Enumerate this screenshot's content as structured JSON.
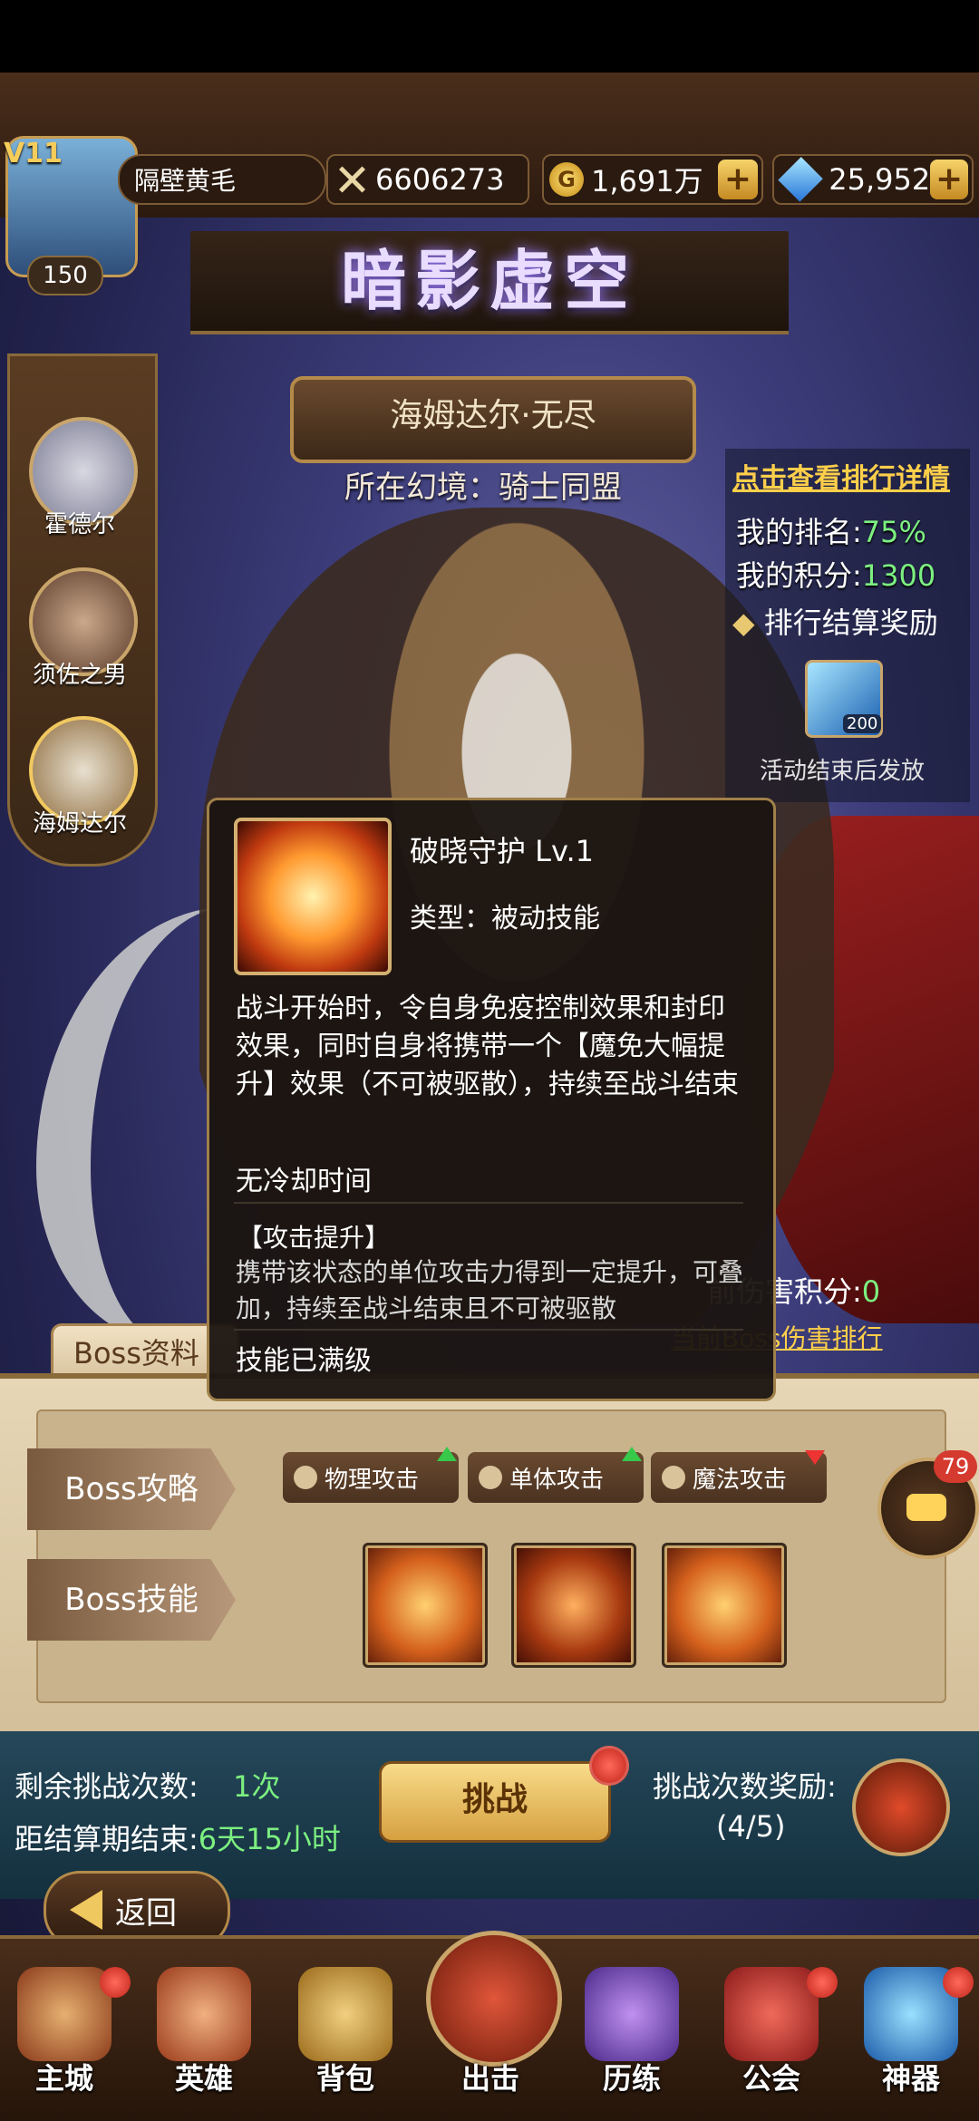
{
  "player": {
    "vip": "V11",
    "level": "150",
    "name": "隔壁黄毛"
  },
  "resources": {
    "power": "6606273",
    "gold": "1,691万",
    "gems": "25,952",
    "plus": "+",
    "coin_glyph": "G"
  },
  "title": "暗影虚空",
  "heroes": [
    {
      "name": "霍德尔"
    },
    {
      "name": "须佐之男"
    },
    {
      "name": "海姆达尔"
    }
  ],
  "stage": {
    "name": "海姆达尔·无尽",
    "realm": "所在幻境：骑士同盟"
  },
  "ranking": {
    "link": "点击查看排行详情",
    "my_rank_label": "我的排名:",
    "my_rank": "75%",
    "my_score_label": "我的积分:",
    "my_score": "1300",
    "reward_label": "排行结算奖励",
    "reward_count": "200",
    "reward_note": "活动结束后发放"
  },
  "damage": {
    "score_label": "前伤害积分:",
    "score": "0",
    "rank_link": "当前Boss伤害排行"
  },
  "boss_tab": "Boss资料",
  "boss_panel": {
    "strategy_label": "Boss攻略",
    "skills_label": "Boss技能",
    "tags": [
      "物理攻击",
      "单体攻击",
      "魔法攻击"
    ],
    "chat_badge": "79"
  },
  "tooltip": {
    "title": "破晓守护  Lv.1",
    "type": "类型：被动技能",
    "desc": "战斗开始时，令自身免疫控制效果和封印效果，同时自身将携带一个【魔免大幅提升】效果（不可被驱散），持续至战斗结束",
    "cooldown": "无冷却时间",
    "buff_title": "【攻击提升】",
    "buff_desc": "携带该状态的单位攻击力得到一定提升，可叠加，持续至战斗结束且不可被驱散",
    "max_level": "技能已满级"
  },
  "info": {
    "remaining_label": "剩余挑战次数:",
    "remaining_value": "1次",
    "end_label": "距结算期结束:",
    "end_value": "6天15小时",
    "challenge": "挑战",
    "reward_label": "挑战次数奖励:",
    "reward_progress": "(4/5)"
  },
  "back": "返回",
  "nav": [
    "主城",
    "英雄",
    "背包",
    "出击",
    "历练",
    "公会",
    "神器"
  ]
}
